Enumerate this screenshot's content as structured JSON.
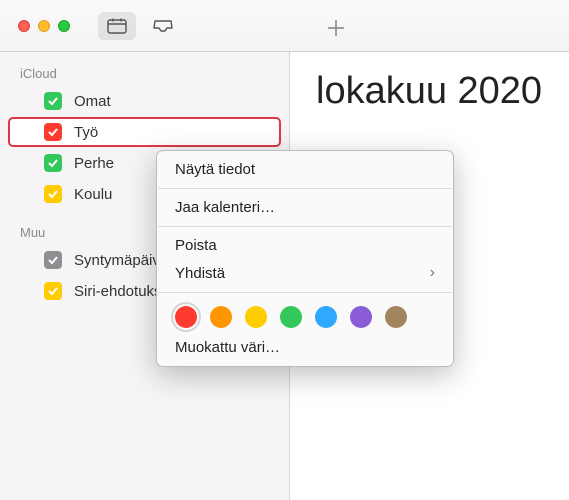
{
  "toolbar": {},
  "sidebar": {
    "sections": [
      {
        "title": "iCloud",
        "items": [
          {
            "label": "Omat",
            "color": "#34c759",
            "selected": false
          },
          {
            "label": "Työ",
            "color": "#ff3b30",
            "selected": true
          },
          {
            "label": "Perhe",
            "color": "#34c759",
            "selected": false
          },
          {
            "label": "Koulu",
            "color": "#ffcc00",
            "selected": false
          }
        ]
      },
      {
        "title": "Muu",
        "items": [
          {
            "label": "Syntymäpäivät",
            "color": "#8e8e93",
            "selected": false
          },
          {
            "label": "Siri-ehdotukset",
            "color": "#ffcc00",
            "selected": false
          }
        ]
      }
    ]
  },
  "main": {
    "month_title": "lokakuu 2020"
  },
  "context_menu": {
    "items": {
      "show_info": "Näytä tiedot",
      "share": "Jaa kalenteri…",
      "delete": "Poista",
      "merge": "Yhdistä",
      "custom_color": "Muokattu väri…"
    },
    "colors": [
      {
        "hex": "#ff3b30",
        "name": "red",
        "selected": true
      },
      {
        "hex": "#ff9500",
        "name": "orange",
        "selected": false
      },
      {
        "hex": "#ffcc00",
        "name": "yellow",
        "selected": false
      },
      {
        "hex": "#34c759",
        "name": "green",
        "selected": false
      },
      {
        "hex": "#2fa8ff",
        "name": "blue",
        "selected": false
      },
      {
        "hex": "#8a5dd6",
        "name": "purple",
        "selected": false
      },
      {
        "hex": "#a2845e",
        "name": "brown",
        "selected": false
      }
    ]
  }
}
